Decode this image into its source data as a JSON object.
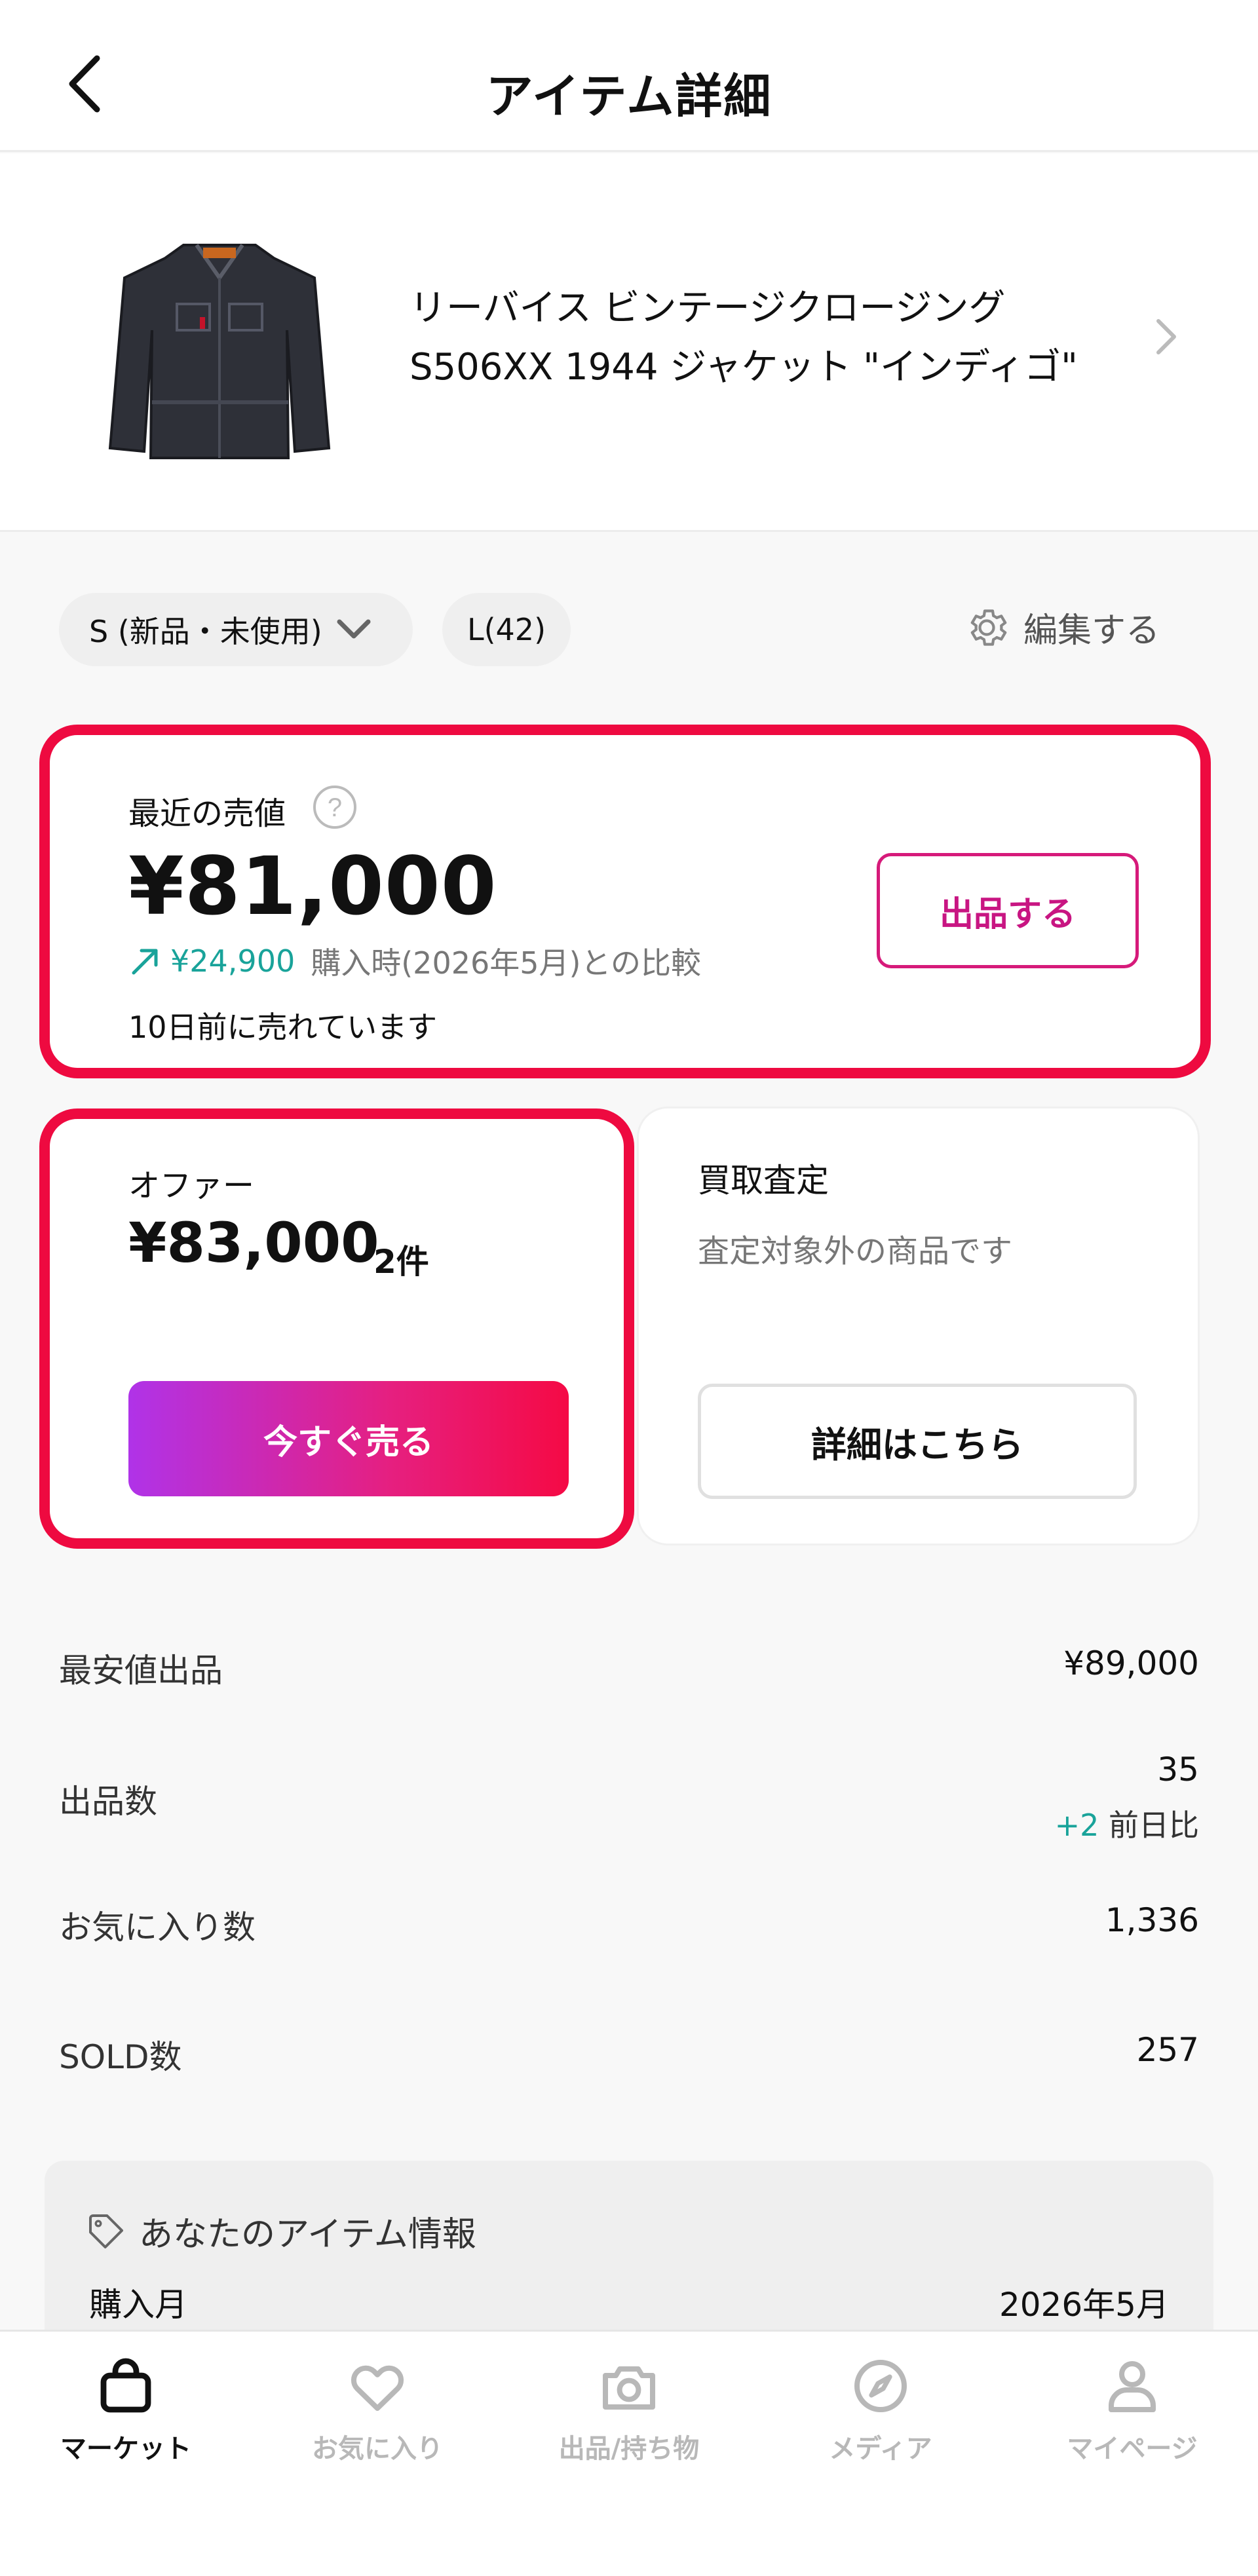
{
  "header": {
    "title": "アイテム詳細"
  },
  "product": {
    "name_line1": "リーバイス ビンテージクロージング",
    "name_line2": "S506XX 1944 ジャケット \"インディゴ\""
  },
  "filters": {
    "size_condition": "S (新品・未使用)",
    "size_label": "L(42)",
    "edit_label": "編集する"
  },
  "recent_price": {
    "label": "最近の売値",
    "price": "¥81,000",
    "change": "¥24,900",
    "compare_text": "購入時(2026年5月)との比較",
    "sold_ago": "10日前に売れています",
    "list_button": "出品する"
  },
  "offer": {
    "label": "オファー",
    "price": "¥83,000",
    "count": "2件",
    "sell_button": "今すぐ売る"
  },
  "kaitori": {
    "title": "買取査定",
    "subtitle": "査定対象外の商品です",
    "detail_button": "詳細はこちら"
  },
  "stats": {
    "lowest_label": "最安値出品",
    "lowest_value": "¥89,000",
    "listings_label": "出品数",
    "listings_value": "35",
    "listings_delta": "+2",
    "listings_delta_label": " 前日比",
    "favorites_label": "お気に入り数",
    "favorites_value": "1,336",
    "sold_label": "SOLD数",
    "sold_value": "257"
  },
  "your_item": {
    "title": "あなたのアイテム情報",
    "purchase_month_label": "購入月",
    "purchase_month_value": "2026年5月"
  },
  "tabs": [
    {
      "label": "マーケット",
      "icon": "bag-icon"
    },
    {
      "label": "お気に入り",
      "icon": "heart-icon"
    },
    {
      "label": "出品/持ち物",
      "icon": "camera-icon"
    },
    {
      "label": "メディア",
      "icon": "compass-icon"
    },
    {
      "label": "マイページ",
      "icon": "person-icon"
    }
  ],
  "colors": {
    "accent_red": "#ee0a40",
    "accent_pink": "#c81582",
    "trend_green": "#19a39a"
  }
}
